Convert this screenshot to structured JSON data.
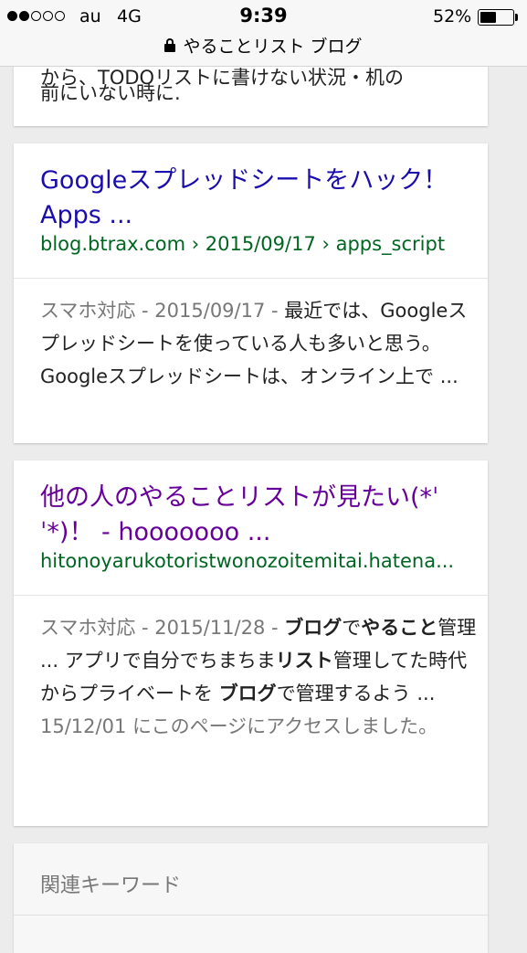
{
  "status_bar": {
    "carrier": "au",
    "network": "4G",
    "time": "9:39",
    "battery_percent": "52%",
    "battery_level": 0.52,
    "signal_bars_filled": 2,
    "signal_bars_total": 5
  },
  "url_bar": {
    "lock_icon": "lock-icon",
    "title": "やることリスト ブログ"
  },
  "results": [
    {
      "clipped_prev_line": "から、TODOリストに書けない状況・机の",
      "last_line": "前にいない時に."
    },
    {
      "title_line1": "Googleスプレッドシートをハック！",
      "title_line2": "Apps ...",
      "source": "blog.btrax.com › 2015/09/17 › apps_script",
      "meta": "スマホ対応 - 2015/09/17 -",
      "snippet": "最近では、Googleスプレッドシートを使っている人も多いと思う。Googleスプレッドシートは、オンライン上で ..."
    },
    {
      "title_line1": "他の人のやることリストが見たい(*ˈ",
      "title_line2": "ˈ*)！ - hooooooo ...",
      "source": "hitonoyarukotoristwonozoitemitai.hatena...",
      "meta": "スマホ対応 - 2015/11/28 -",
      "snippet_parts": {
        "b1": "ブログ",
        "t1": "で",
        "b2": "やること",
        "t2": "管理 ... アプリで自分でちまちま",
        "b3": "リスト",
        "t3": "管理してた時代からプライベートを ",
        "b4": "ブログ",
        "t4": "で管理するよう ..."
      },
      "visited": "15/12/01 にこのページにアクセスしました。"
    }
  ],
  "related": {
    "header": "関連キーワード"
  },
  "colors": {
    "link_unvisited": "#1a0dab",
    "link_visited": "#660099",
    "source_green": "#006621",
    "meta_gray": "#777777"
  }
}
